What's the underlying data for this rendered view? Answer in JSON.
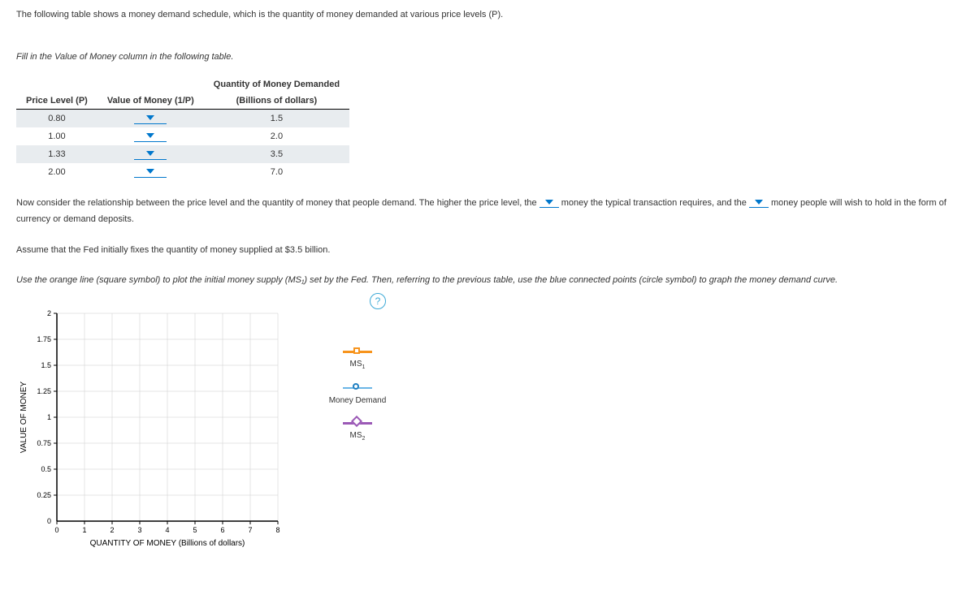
{
  "intro_text": "The following table shows a money demand schedule, which is the quantity of money demanded at various price levels (P).",
  "fill_instruction": "Fill in the Value of Money column in the following table.",
  "table": {
    "headers": {
      "col1": "Price Level (P)",
      "col2": "Value of Money (1/P)",
      "col3_top": "Quantity of Money Demanded",
      "col3_sub": "(Billions of dollars)"
    },
    "rows": [
      {
        "p": "0.80",
        "q": "1.5"
      },
      {
        "p": "1.00",
        "q": "2.0"
      },
      {
        "p": "1.33",
        "q": "3.5"
      },
      {
        "p": "2.00",
        "q": "7.0"
      }
    ]
  },
  "para1": {
    "pre": "Now consider the relationship between the price level and the quantity of money that people demand. The higher the price level, the ",
    "mid": " money the typical transaction requires, and the ",
    "post": " money people will wish to hold in the form of currency or demand deposits."
  },
  "para2": "Assume that the Fed initially fixes the quantity of money supplied at $3.5 billion.",
  "para3": "Use the orange line (square symbol) to plot the initial money supply (MS₁) set by the Fed. Then, referring to the previous table, use the blue connected points (circle symbol) to graph the money demand curve.",
  "help_icon": "?",
  "chart_data": {
    "type": "scatter",
    "title": "",
    "xlabel": "QUANTITY OF MONEY (Billions of dollars)",
    "ylabel": "VALUE OF MONEY",
    "xlim": [
      0,
      8
    ],
    "ylim": [
      0,
      2.0
    ],
    "xticks": [
      0,
      1,
      2,
      3,
      4,
      5,
      6,
      7,
      8
    ],
    "yticks": [
      0,
      0.25,
      0.5,
      0.75,
      1.0,
      1.25,
      1.5,
      1.75,
      2.0
    ],
    "series": []
  },
  "legend": {
    "ms1_label": "MS",
    "ms1_sub": "1",
    "md_label": "Money Demand",
    "ms2_label": "MS",
    "ms2_sub": "2"
  }
}
